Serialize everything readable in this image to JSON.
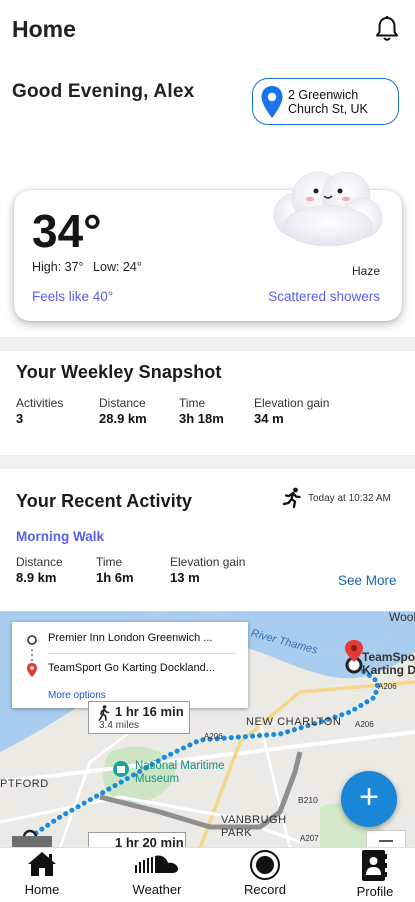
{
  "header": {
    "title": "Home",
    "notifications_icon": "bell-icon"
  },
  "greeting": "Good Evening, Alex",
  "location": {
    "icon": "map-pin-icon",
    "line1": "2 Greenwich",
    "line2": "Church St, UK"
  },
  "weather": {
    "temperature": "34°",
    "high": "High: 37°",
    "low": "Low: 24°",
    "condition": "Haze",
    "feels_like": "Feels like 40°",
    "forecast": "Scattered showers",
    "illustration": "cute-cloud-icon"
  },
  "weekly_snapshot": {
    "title": "Your Weekley Snapshot",
    "stats": [
      {
        "label": "Activities",
        "value": "3"
      },
      {
        "label": "Distance",
        "value": "28.9 km"
      },
      {
        "label": "Time",
        "value": "3h 18m"
      },
      {
        "label": "Elevation gain",
        "value": "34 m"
      }
    ]
  },
  "recent_activity": {
    "title": "Your Recent Activity",
    "timestamp": "Today at 10:32 AM",
    "activity_icon": "running-person-icon",
    "activity_name": "Morning Walk",
    "stats": [
      {
        "label": "Distance",
        "value": "8.9 km"
      },
      {
        "label": "Time",
        "value": "1h 6m"
      },
      {
        "label": "Elevation gain",
        "value": "13 m"
      }
    ],
    "see_more": "See More"
  },
  "map": {
    "origin": "Premier Inn London Greenwich ...",
    "destination": "TeamSport Go Karting Dockland...",
    "more_options": "More options",
    "eta": "1 hr 16 min",
    "eta_distance": "3.4 miles",
    "eta_partial": "1 hr 20 min",
    "dest_marker_line1": "TeamSpo",
    "dest_marker_line2": "Karting D",
    "labels": {
      "woolwich": "Woolv",
      "river": "River Thames",
      "new_charlton": "NEW CHARLTON",
      "museum_line1": "National Maritime",
      "museum_line2": "Museum",
      "deptford": "PTFORD",
      "vanbrugh_1": "VANBRUGH",
      "vanbrugh_2": "PARK",
      "a206_a": "A206",
      "a206_b": "A206",
      "a206_c": "A206",
      "b210": "B210",
      "a207": "A207"
    },
    "fab_label": "+"
  },
  "bottom_nav": [
    {
      "label": "Home",
      "icon": "home-icon"
    },
    {
      "label": "Weather",
      "icon": "soundcloud-icon"
    },
    {
      "label": "Record",
      "icon": "record-icon"
    },
    {
      "label": "Profile",
      "icon": "contact-book-icon"
    }
  ],
  "colors": {
    "accent": "#5b5ef0",
    "link": "#1565c0",
    "fab": "#1a86d8",
    "route": "#1a8be0",
    "pin_red": "#e53935"
  }
}
